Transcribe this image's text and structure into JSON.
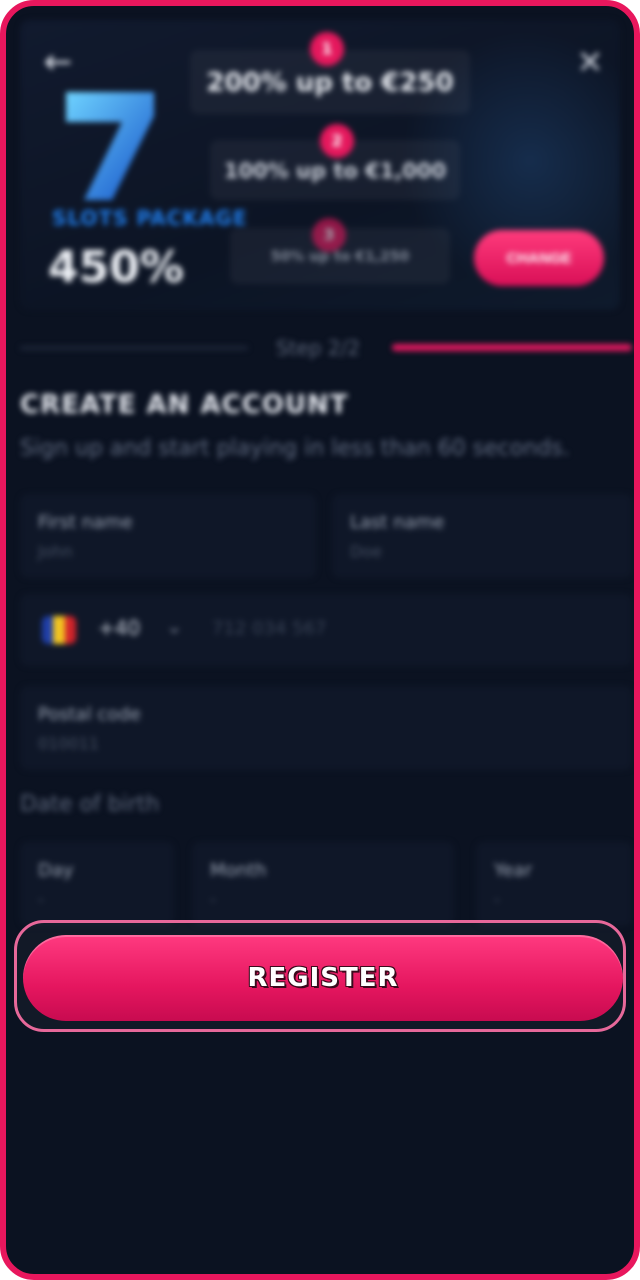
{
  "header": {
    "back_icon": "arrow-left-icon",
    "close_icon": "close-icon",
    "package_label": "SLOTS PACKAGE",
    "package_percent": "450%",
    "offers": [
      {
        "badge": "1",
        "text": "200% up to €250"
      },
      {
        "badge": "2",
        "text": "100% up to €1,000"
      },
      {
        "badge": "3",
        "text": "50% up to €1,250"
      }
    ],
    "change_label": "CHANGE"
  },
  "step": {
    "label": "Step 2/2"
  },
  "form": {
    "title": "CREATE AN ACCOUNT",
    "subtitle": "Sign up and start playing in less than 60 seconds.",
    "first_name": {
      "label": "First name",
      "placeholder": "John"
    },
    "last_name": {
      "label": "Last name",
      "placeholder": "Doe"
    },
    "phone": {
      "dial_code": "+40",
      "placeholder": "712 034 567"
    },
    "postal_code": {
      "label": "Postal code",
      "placeholder": "010011"
    },
    "dob_label": "Date of birth",
    "day": {
      "label": "Day",
      "placeholder": "-"
    },
    "month": {
      "label": "Month",
      "placeholder": "-"
    },
    "year": {
      "label": "Year",
      "placeholder": "-"
    }
  },
  "register_label": "REGISTER",
  "colors": {
    "accent": "#e5185d",
    "background": "#0b1221",
    "frame": "#e8175d"
  }
}
